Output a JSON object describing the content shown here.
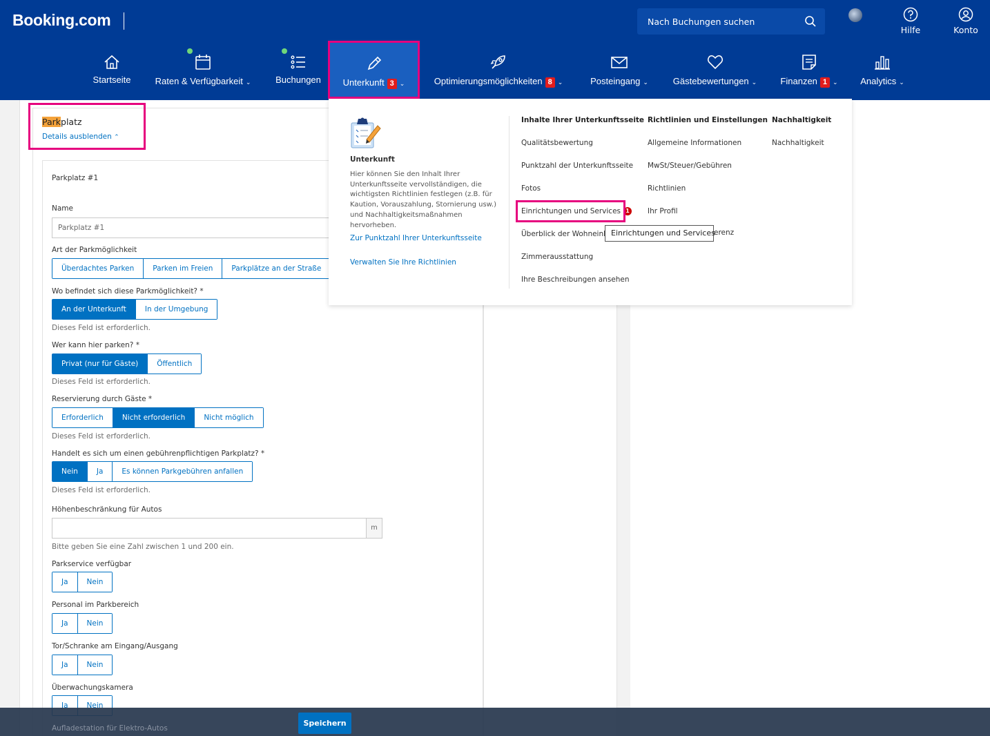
{
  "header": {
    "logo": "Booking.com",
    "search_placeholder": "Nach Buchungen suchen",
    "help_label": "Hilfe",
    "account_label": "Konto"
  },
  "nav": {
    "home": "Startseite",
    "rates": "Raten & Verfügbarkeit",
    "bookings": "Buchungen",
    "property": "Unterkunft",
    "property_badge": "3",
    "optimization": "Optimierungsmöglichkeiten",
    "optimization_badge": "8",
    "inbox": "Posteingang",
    "reviews": "Gästebewertungen",
    "finance": "Finanzen",
    "finance_badge": "1",
    "analytics": "Analytics"
  },
  "section": {
    "title_highlight": "Park",
    "title_rest": "platz",
    "toggle": "Details ausblenden",
    "subtitle": "Parkplatz #1"
  },
  "form": {
    "name_label": "Name",
    "name_value": "Parkplatz #1",
    "type_label": "Art der Parkmöglichkeit",
    "type_options": [
      "Überdachtes Parken",
      "Parken im Freien",
      "Parkplätze an der Straße"
    ],
    "location_label": "Wo befindet sich diese Parkmöglichkeit? *",
    "location_options": [
      "An der Unterkunft",
      "In der Umgebung"
    ],
    "required_msg": "Dieses Feld ist erforderlich.",
    "who_label": "Wer kann hier parken? *",
    "who_options": [
      "Privat (nur für Gäste)",
      "Öffentlich"
    ],
    "reservation_label": "Reservierung durch Gäste *",
    "reservation_options": [
      "Erforderlich",
      "Nicht erforderlich",
      "Nicht möglich"
    ],
    "fee_label": "Handelt es sich um einen gebührenpflichtigen Parkplatz? *",
    "fee_options": [
      "Nein",
      "Ja",
      "Es können Parkgebühren anfallen"
    ],
    "height_label": "Höhenbeschränkung für Autos",
    "height_unit": "m",
    "height_hint": "Bitte geben Sie eine Zahl zwischen 1 und 200 ein.",
    "valet_label": "Parkservice verfügbar",
    "staff_label": "Personal im Parkbereich",
    "gate_label": "Tor/Schranke am Eingang/Ausgang",
    "camera_label": "Überwachungskamera",
    "ev_label": "Aufladestation für Elektro-Autos",
    "yes": "Ja",
    "no": "Nein"
  },
  "footer": {
    "save": "Speichern"
  },
  "dropdown": {
    "title": "Unterkunft",
    "description": "Hier können Sie den Inhalt Ihrer Unterkunftsseite vervollständigen, die wichtigsten Richtlinien festlegen (z.B. für Kaution, Vorauszahlung, Stornierung usw.) und Nachhaltigkeitsmaßnahmen hervorheben.",
    "link_score": "Zur Punktzahl Ihrer Unterkunftsseite",
    "link_policies": "Verwalten Sie Ihre Richtlinien",
    "col1_title": "Inhalte Ihrer Unterkunftsseite",
    "col1_items": [
      "Qualitätsbewertung",
      "Punktzahl der Unterkunftsseite",
      "Fotos",
      "Einrichtungen und Services",
      "Überblick der Wohneinhei",
      "Zimmerausstattung",
      "Ihre Beschreibungen ansehen"
    ],
    "col1_badge": "1",
    "col2_title": "Richtlinien und Einstellungen",
    "col2_items": [
      "Allgemeine Informationen",
      "MwSt/Steuer/Gebühren",
      "Richtlinien",
      "Ihr Profil"
    ],
    "col2_partial": "erenz",
    "col3_title": "Nachhaltigkeit",
    "col3_items": [
      "Nachhaltigkeit"
    ],
    "tooltip": "Einrichtungen und Services"
  },
  "colors": {
    "brand": "#003b95",
    "accent": "#0071c2",
    "highlight": "#e6007e",
    "badge": "#e21c1c"
  }
}
